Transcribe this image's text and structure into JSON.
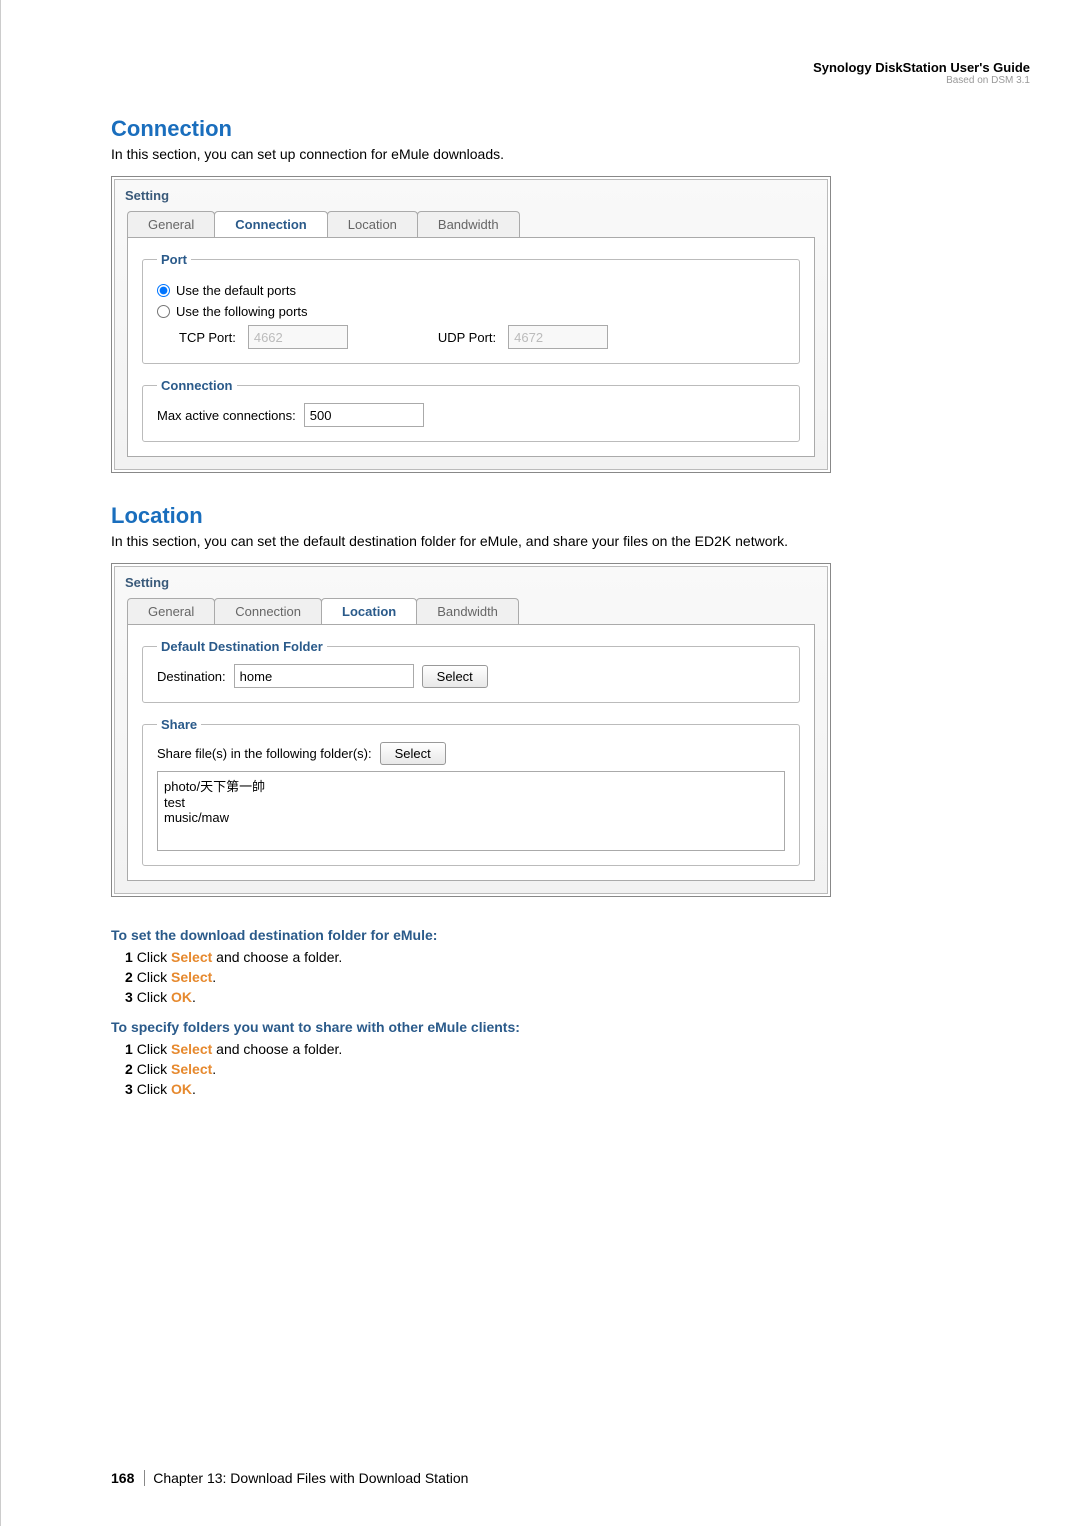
{
  "header": {
    "guide_title": "Synology DiskStation User's Guide",
    "based_on": "Based on DSM 3.1"
  },
  "connection_section": {
    "heading": "Connection",
    "desc": "In this section, you can set up connection for eMule downloads."
  },
  "screenshot1": {
    "title": "Setting",
    "tabs": {
      "general": "General",
      "connection": "Connection",
      "location": "Location",
      "bandwidth": "Bandwidth"
    },
    "port": {
      "legend": "Port",
      "default_label": "Use the default ports",
      "following_label": "Use the following ports",
      "tcp_label": "TCP Port:",
      "tcp_value": "4662",
      "udp_label": "UDP Port:",
      "udp_value": "4672"
    },
    "conn": {
      "legend": "Connection",
      "max_label": "Max active connections:",
      "max_value": "500"
    }
  },
  "location_section": {
    "heading": "Location",
    "desc": "In this section, you can set the default destination folder for eMule, and share your files on the ED2K network."
  },
  "screenshot2": {
    "title": "Setting",
    "tabs": {
      "general": "General",
      "connection": "Connection",
      "location": "Location",
      "bandwidth": "Bandwidth"
    },
    "dest": {
      "legend": "Default Destination Folder",
      "label": "Destination:",
      "value": "home",
      "select_btn": "Select"
    },
    "share": {
      "legend": "Share",
      "label": "Share file(s) in the following folder(s):",
      "select_btn": "Select",
      "list": "photo/天下第一帥\ntest\nmusic/maw"
    }
  },
  "instructions1": {
    "heading": "To set the download destination folder for eMule:",
    "steps": {
      "n1": "1",
      "s1a": "Click ",
      "s1b": "Select",
      "s1c": " and choose a folder.",
      "n2": "2",
      "s2a": "Click ",
      "s2b": "Select",
      "s2c": ".",
      "n3": "3",
      "s3a": "Click ",
      "s3b": "OK",
      "s3c": "."
    }
  },
  "instructions2": {
    "heading": "To specify folders you want to share with other eMule clients:",
    "steps": {
      "n1": "1",
      "s1a": "Click ",
      "s1b": "Select",
      "s1c": " and choose a folder.",
      "n2": "2",
      "s2a": "Click ",
      "s2b": "Select",
      "s2c": ".",
      "n3": "3",
      "s3a": "Click ",
      "s3b": "OK",
      "s3c": "."
    }
  },
  "footer": {
    "page": "168",
    "chapter": "Chapter 13: Download Files with Download Station"
  }
}
